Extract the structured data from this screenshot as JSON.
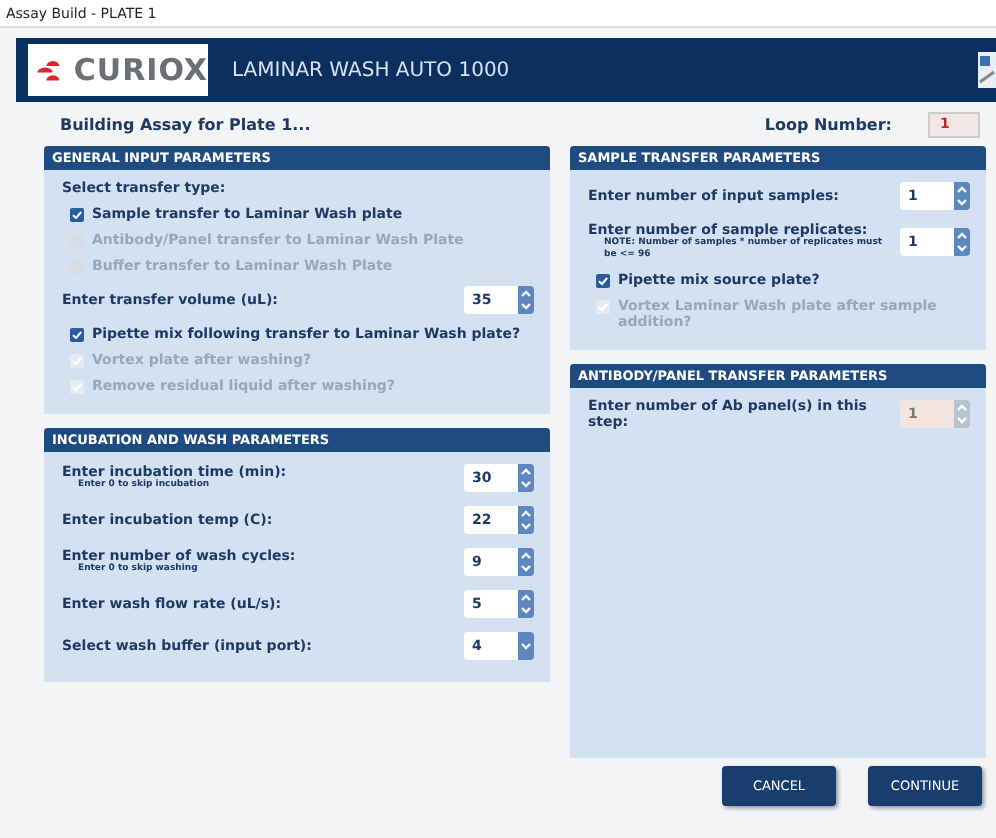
{
  "window": {
    "title": "Assay Build - PLATE 1"
  },
  "header": {
    "logo": "CURIOX",
    "title": "LAMINAR WASH AUTO 1000"
  },
  "status": {
    "text": "Building Assay for Plate 1...",
    "loop_label": "Loop Number:",
    "loop_value": "1"
  },
  "columns": [
    {
      "panels": [
        {
          "title": "GENERAL INPUT PARAMETERS",
          "fill": false,
          "items": [
            {
              "kind": "label",
              "text": "Select transfer type:"
            },
            {
              "kind": "checkbox",
              "text": "Sample transfer to Laminar Wash plate",
              "checked": true,
              "disabled": false
            },
            {
              "kind": "checkbox",
              "text": "Antibody/Panel transfer to Laminar Wash Plate",
              "checked": false,
              "disabled": true
            },
            {
              "kind": "checkbox",
              "text": "Buffer transfer to Laminar Wash Plate",
              "checked": false,
              "disabled": true
            },
            {
              "kind": "number",
              "text": "Enter transfer volume (uL):",
              "value": "35",
              "disabled": false
            },
            {
              "kind": "checkbox",
              "text": "Pipette mix following transfer to Laminar Wash plate?",
              "checked": true,
              "disabled": false
            },
            {
              "kind": "checkbox",
              "text": "Vortex plate after washing?",
              "checked": true,
              "disabled": true
            },
            {
              "kind": "checkbox",
              "text": "Remove residual liquid after washing?",
              "checked": true,
              "disabled": true
            }
          ]
        },
        {
          "title": "INCUBATION AND WASH PARAMETERS",
          "fill": false,
          "items": [
            {
              "kind": "number",
              "text": "Enter incubation time (min):",
              "hint": "Enter 0 to skip incubation",
              "value": "30",
              "disabled": false
            },
            {
              "kind": "number",
              "text": "Enter incubation temp (C):",
              "value": "22",
              "disabled": false
            },
            {
              "kind": "number",
              "text": "Enter number of wash cycles:",
              "hint": "Enter 0 to skip washing",
              "value": "9",
              "disabled": false
            },
            {
              "kind": "number",
              "text": "Enter wash flow rate (uL/s):",
              "value": "5",
              "disabled": false
            },
            {
              "kind": "select",
              "text": "Select wash buffer (input port):",
              "value": "4",
              "disabled": false
            }
          ]
        }
      ]
    },
    {
      "panels": [
        {
          "title": "SAMPLE TRANSFER PARAMETERS",
          "fill": false,
          "items": [
            {
              "kind": "number",
              "text": "Enter number of input samples:",
              "value": "1",
              "disabled": false
            },
            {
              "kind": "number",
              "text": "Enter number of sample replicates:",
              "hint": "NOTE: Number of samples * number of replicates must be <= 96",
              "value": "1",
              "disabled": false
            },
            {
              "kind": "checkbox",
              "text": "Pipette mix source plate?",
              "checked": true,
              "disabled": false
            },
            {
              "kind": "checkbox",
              "text": "Vortex Laminar Wash plate after sample addition?",
              "checked": true,
              "disabled": true
            }
          ]
        },
        {
          "title": "ANTIBODY/PANEL TRANSFER PARAMETERS",
          "fill": true,
          "items": [
            {
              "kind": "number",
              "text": "Enter number of Ab panel(s) in this step:",
              "value": "1",
              "disabled": true
            }
          ]
        }
      ]
    }
  ],
  "buttons": [
    {
      "label": "CANCEL"
    },
    {
      "label": "CONTINUE"
    }
  ]
}
